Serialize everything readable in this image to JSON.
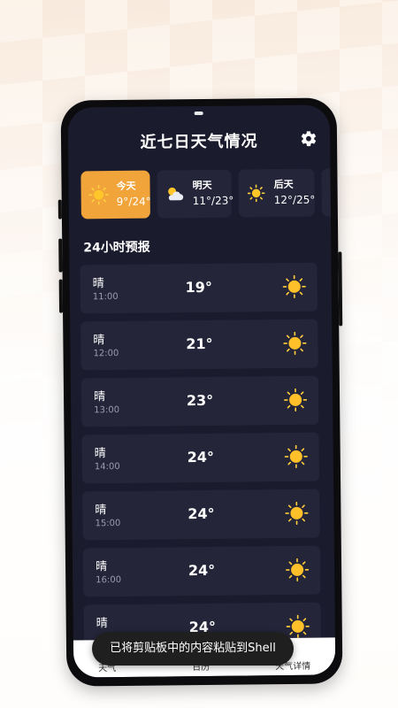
{
  "header": {
    "title": "近七日天气情况",
    "settings_icon": "gear-icon"
  },
  "days": [
    {
      "name": "今天",
      "range": "9°/24°",
      "icon": "sun-icon",
      "active": true
    },
    {
      "name": "明天",
      "range": "11°/23°",
      "icon": "partly-cloudy-icon",
      "active": false
    },
    {
      "name": "后天",
      "range": "12°/25°",
      "icon": "sun-icon",
      "active": false
    }
  ],
  "hourly": {
    "title": "24小时预报",
    "rows": [
      {
        "condition": "晴",
        "time": "11:00",
        "temp": "19°",
        "icon": "sun-icon"
      },
      {
        "condition": "晴",
        "time": "12:00",
        "temp": "21°",
        "icon": "sun-icon"
      },
      {
        "condition": "晴",
        "time": "13:00",
        "temp": "23°",
        "icon": "sun-icon"
      },
      {
        "condition": "晴",
        "time": "14:00",
        "temp": "24°",
        "icon": "sun-icon"
      },
      {
        "condition": "晴",
        "time": "15:00",
        "temp": "24°",
        "icon": "sun-icon"
      },
      {
        "condition": "晴",
        "time": "16:00",
        "temp": "24°",
        "icon": "sun-icon"
      },
      {
        "condition": "晴",
        "time": "",
        "temp": "24°",
        "icon": "sun-icon"
      }
    ]
  },
  "nav": {
    "items": [
      "天气",
      "日历",
      "天气详情"
    ]
  },
  "toast": {
    "text": "已将剪贴板中的内容粘贴到Shell"
  },
  "colors": {
    "accent": "#f0a43a",
    "card": "#25253a",
    "screen": "#1b1b2e"
  }
}
